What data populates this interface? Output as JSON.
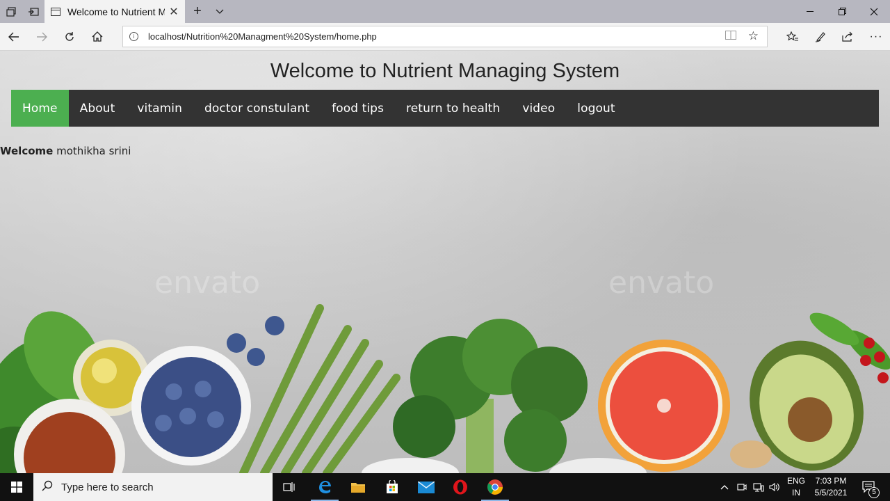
{
  "browser": {
    "tab_title": "Welcome to Nutrient M",
    "url": "localhost/Nutrition%20Managment%20System/home.php",
    "icons": {
      "tab_manager": "tab-manager-icon",
      "set_aside": "set-aside-tabs-icon",
      "new_tab": "plus-icon",
      "tab_list": "chevron-down-icon",
      "minimize": "minimize-icon",
      "restore": "restore-icon",
      "close": "close-icon",
      "back": "back-arrow-icon",
      "forward": "forward-arrow-icon",
      "refresh": "refresh-icon",
      "home": "home-icon",
      "reading_view": "reading-view-icon",
      "favorite": "star-icon",
      "favorites_hub": "favorites-icon",
      "notes": "pen-icon",
      "share": "share-icon",
      "more": "more-icon"
    }
  },
  "page": {
    "title": "Welcome to Nutrient Managing System",
    "nav": [
      {
        "label": "Home",
        "active": true
      },
      {
        "label": "About",
        "active": false
      },
      {
        "label": "vitamin",
        "active": false
      },
      {
        "label": "doctor constulant",
        "active": false
      },
      {
        "label": "food tips",
        "active": false
      },
      {
        "label": "return to health",
        "active": false
      },
      {
        "label": "video",
        "active": false
      },
      {
        "label": "logout",
        "active": false
      }
    ],
    "welcome_label": "Welcome",
    "user_name": "mothikha srini",
    "watermark": "envato"
  },
  "taskbar": {
    "search_placeholder": "Type here to search",
    "apps": [
      "task-view-icon",
      "edge-icon",
      "file-explorer-icon",
      "store-icon",
      "mail-icon",
      "opera-icon",
      "chrome-icon"
    ],
    "language_line1": "ENG",
    "language_line2": "IN",
    "time": "7:03 PM",
    "date": "5/5/2021",
    "notification_count": "5"
  },
  "colors": {
    "nav_bg": "#333333",
    "nav_active": "#4caf50",
    "tabbar": "#b7b7c0",
    "taskbar": "#111111"
  }
}
